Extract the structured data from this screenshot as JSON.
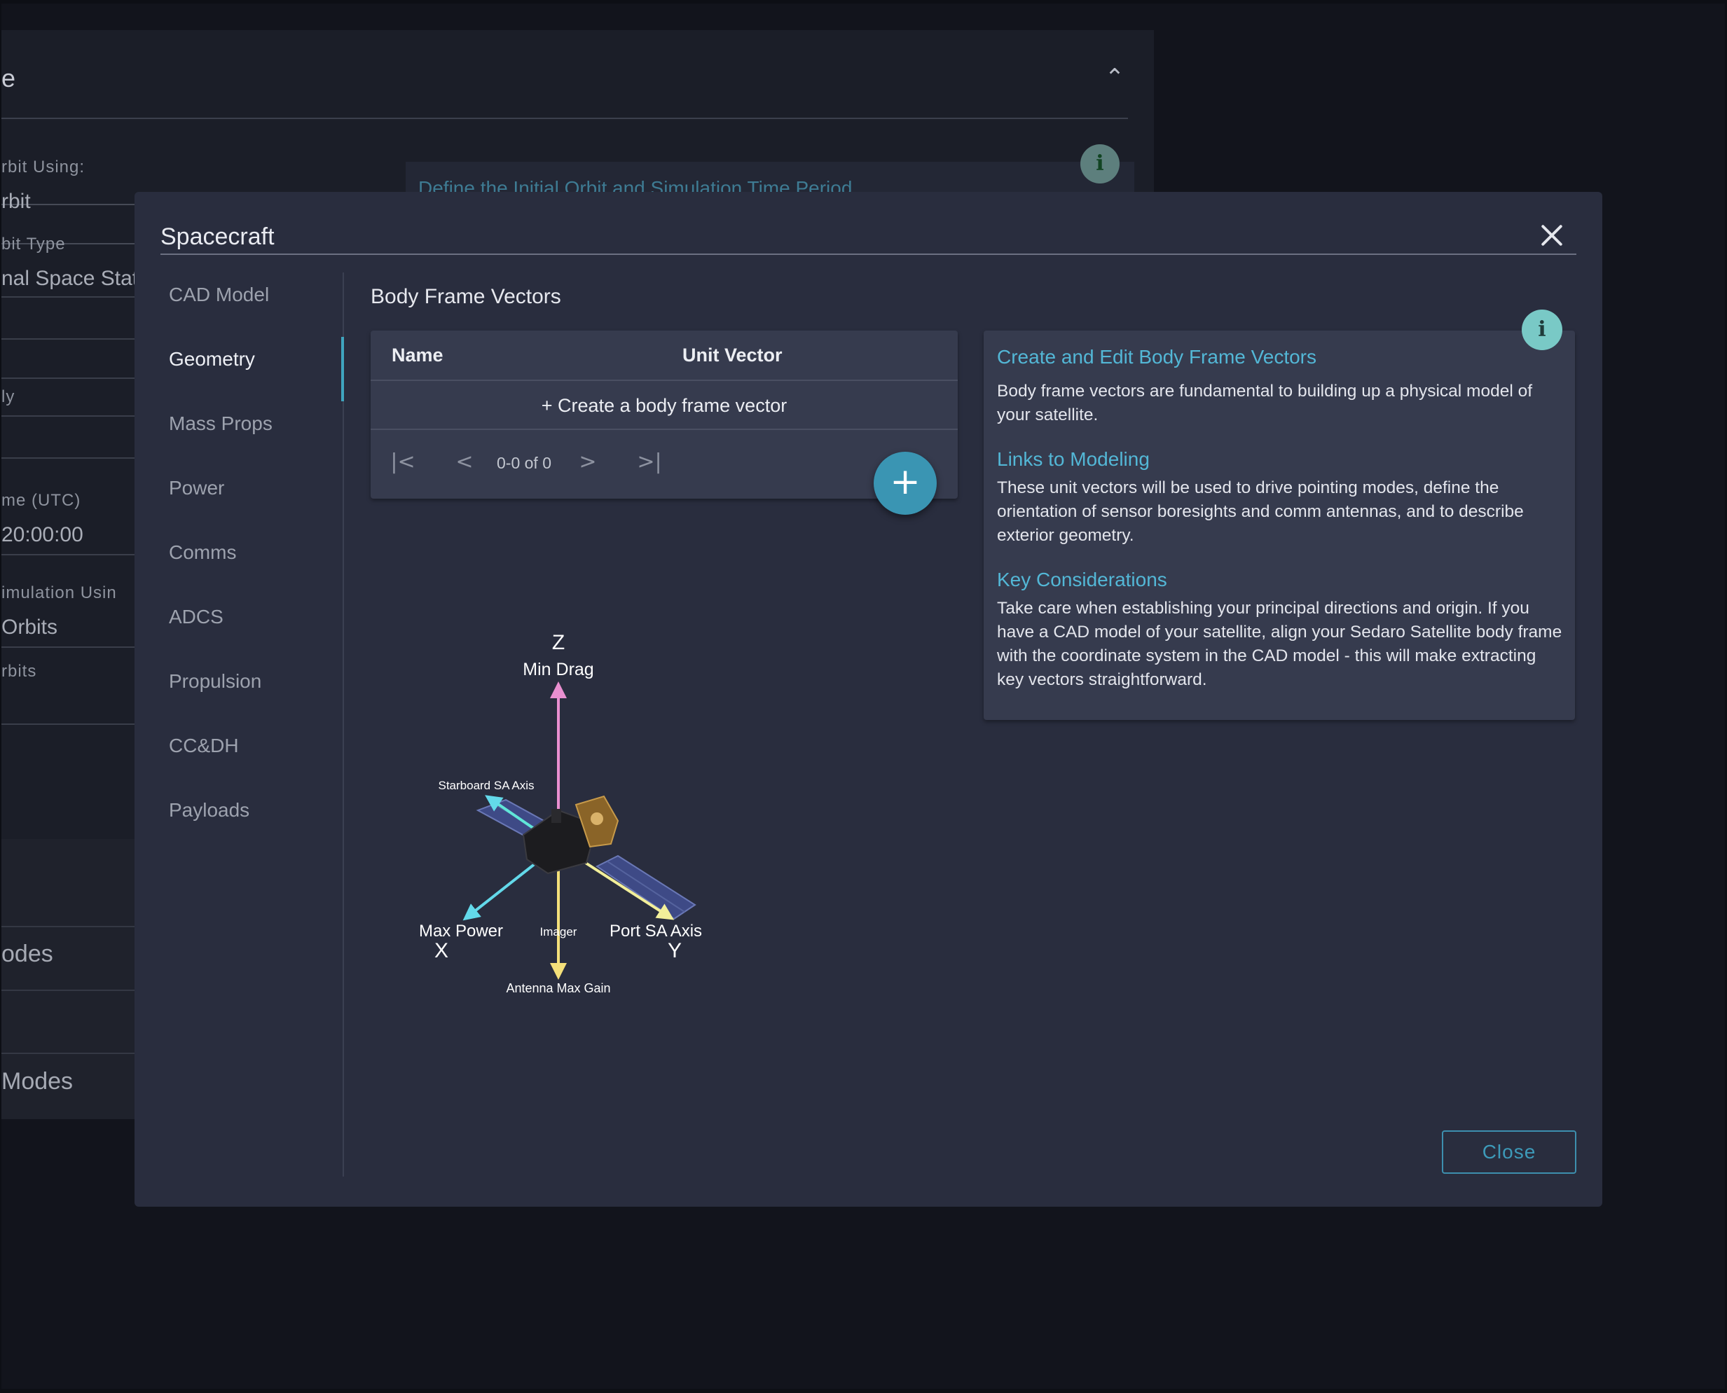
{
  "background": {
    "panel_title": "e",
    "define_link": "Define the Initial Orbit and Simulation Time Period",
    "fields": [
      {
        "label": "rbit Using:",
        "value": "rbit"
      },
      {
        "label": "bit Type",
        "value": "nal Space Stati"
      },
      {
        "label": "ly",
        "value": ""
      },
      {
        "label": "me (UTC)",
        "value": " 20:00:00"
      },
      {
        "label": "imulation Usin",
        "value": "Orbits"
      },
      {
        "label": "rbits",
        "value": ""
      }
    ],
    "lower_items": [
      "odes",
      " Modes"
    ]
  },
  "modal": {
    "title": "Spacecraft",
    "nav": [
      {
        "label": "CAD Model",
        "active": false
      },
      {
        "label": "Geometry",
        "active": true
      },
      {
        "label": "Mass Props",
        "active": false
      },
      {
        "label": "Power",
        "active": false
      },
      {
        "label": "Comms",
        "active": false
      },
      {
        "label": "ADCS",
        "active": false
      },
      {
        "label": "Propulsion",
        "active": false
      },
      {
        "label": "CC&DH",
        "active": false
      },
      {
        "label": "Payloads",
        "active": false
      }
    ],
    "section_title": "Body Frame Vectors",
    "table": {
      "columns": [
        "Name",
        "Unit Vector"
      ],
      "create_row": "+ Create a body frame vector",
      "pager_range": "0-0 of 0"
    },
    "fab_icon": "plus-icon",
    "info": {
      "heading_1": "Create and Edit Body Frame Vectors",
      "text_1": "Body frame vectors are fundamental to building up a physical model of your satellite.",
      "heading_2": "Links to Modeling",
      "text_2": "These unit vectors will be used to drive pointing modes, define the orientation of sensor boresights and comm antennas, and to describe exterior geometry.",
      "heading_3": "Key Considerations",
      "text_3": "Take care when establishing your principal directions and origin. If you have a CAD model of your satellite, align your Sedaro Satellite body frame with the coordinate system in the CAD model - this will make extracting key vectors straightforward."
    },
    "diagram": {
      "axis_z": "Z",
      "axis_x": "X",
      "axis_y": "Y",
      "min_drag": "Min Drag",
      "starboard": "Starboard SA Axis",
      "max_power": "Max Power",
      "imager": "Imager",
      "port": "Port SA Axis",
      "antenna": "Antenna Max Gain"
    },
    "close_button": "Close",
    "colors": {
      "accent": "#3fa5bf",
      "link": "#53b7d6",
      "modal_bg": "#292d3e",
      "card_bg": "#363b4e",
      "z_axis": "#e98fd0",
      "x_axis": "#63d9ea",
      "y_axis": "#f2ef9a",
      "starboard_axis": "#60e6d8",
      "antenna_axis": "#f4e07a"
    }
  }
}
